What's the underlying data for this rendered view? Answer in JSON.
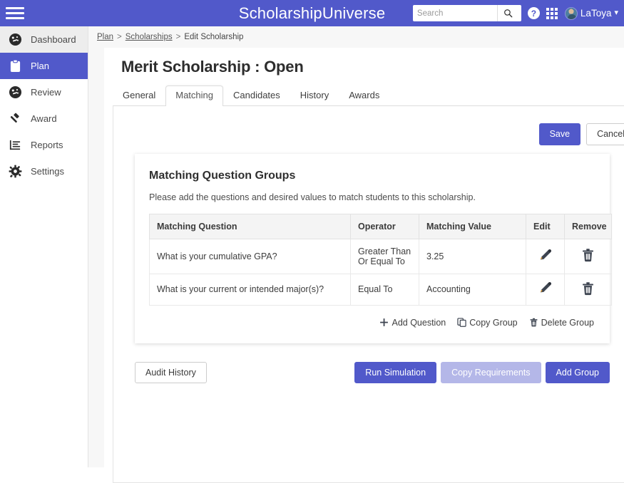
{
  "theme": {
    "brand_purple": "#5159ca",
    "muted_purple": "#b4b7e8",
    "page_bg": "#f7f7f7",
    "header_row_bg": "#f4f4f4"
  },
  "topbar": {
    "menu_icon": "hamburger-icon",
    "brand": "ScholarshipUniverse",
    "search": {
      "placeholder": "Search",
      "value": "",
      "button_icon": "search-icon"
    },
    "help_label": "?",
    "help_icon": "help-circle-icon",
    "apps_icon": "grid-apps-icon",
    "user": {
      "name": "LaToya",
      "avatar_icon": "user-avatar",
      "chevron": "⌄"
    }
  },
  "sidebar": {
    "items": [
      {
        "label": "Dashboard",
        "icon": "speedometer-icon",
        "state": "hovered"
      },
      {
        "label": "Plan",
        "icon": "clipboard-icon",
        "state": "active"
      },
      {
        "label": "Review",
        "icon": "speedometer-icon",
        "state": ""
      },
      {
        "label": "Award",
        "icon": "gavel-icon",
        "state": ""
      },
      {
        "label": "Reports",
        "icon": "bar-chart-icon",
        "state": ""
      },
      {
        "label": "Settings",
        "icon": "gear-icon",
        "state": ""
      }
    ]
  },
  "breadcrumb": {
    "items": [
      {
        "label": "Plan",
        "link": true
      },
      {
        "label": "Scholarships",
        "link": true
      },
      {
        "label": "Edit Scholarship",
        "link": false
      }
    ],
    "separator": ">"
  },
  "page": {
    "title": "Merit Scholarship : Open"
  },
  "tabs": [
    {
      "label": "General",
      "active": false
    },
    {
      "label": "Matching",
      "active": true
    },
    {
      "label": "Candidates",
      "active": false
    },
    {
      "label": "History",
      "active": false
    },
    {
      "label": "Awards",
      "active": false
    }
  ],
  "toolbar": {
    "save_label": "Save",
    "cancel_label": "Cancel"
  },
  "card": {
    "title": "Matching Question Groups",
    "subtitle": "Please add the questions and desired values to match students to this scholarship.",
    "table": {
      "headers": [
        "Matching Question",
        "Operator",
        "Matching Value",
        "Edit",
        "Remove"
      ],
      "rows": [
        {
          "question": "What is your cumulative GPA?",
          "operator": "Greater Than Or Equal To",
          "value": "3.25",
          "edit_icon": "pencil-icon",
          "remove_icon": "trash-icon"
        },
        {
          "question": "What is your current or intended major(s)?",
          "operator": "Equal To",
          "value": "Accounting",
          "edit_icon": "pencil-icon",
          "remove_icon": "trash-icon"
        }
      ]
    },
    "group_actions": [
      {
        "label": "Add Question",
        "icon": "plus-icon"
      },
      {
        "label": "Copy Group",
        "icon": "copy-icon"
      },
      {
        "label": "Delete Group",
        "icon": "trash-icon"
      }
    ]
  },
  "bottom": {
    "audit_history_label": "Audit History",
    "run_simulation_label": "Run Simulation",
    "copy_requirements_label": "Copy Requirements",
    "add_group_label": "Add Group"
  }
}
